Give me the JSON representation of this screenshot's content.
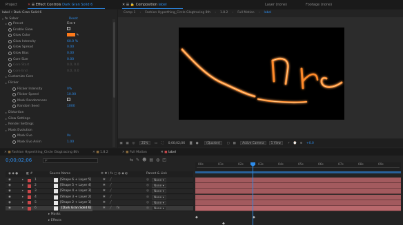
{
  "panels": {
    "project_tab": "Project",
    "effect_controls_tab": "Effect Controls",
    "effect_controls_layer": "Dark Gran Solid 6",
    "composition_tab": "Composition",
    "composition_name": "label",
    "layer_tab": "Layer (none)",
    "footage_tab": "Footage (none)"
  },
  "breadcrumbs": [
    "Comp 1",
    "Fashion Hyperthing_Circle Glogtracing 8th",
    "1.8.2",
    "Full Motion",
    "label"
  ],
  "effect_controls": {
    "title": "label • Dark Gran Solid 6",
    "effect_name": "Saber",
    "effect_reset": "Reset",
    "rows": [
      {
        "label": "Preset",
        "value": "Fire",
        "dim": false
      },
      {
        "label": "Enable Glow",
        "value": "",
        "dim": false
      },
      {
        "label": "Glow Color",
        "value": "",
        "dim": false
      },
      {
        "label": "Glow Intensity",
        "value": "60.0 %",
        "dim": false
      },
      {
        "label": "Glow Spread",
        "value": "0.00",
        "dim": false
      },
      {
        "label": "Glow Bias",
        "value": "0.00",
        "dim": false
      },
      {
        "label": "Core Size",
        "value": "0.00",
        "dim": false
      },
      {
        "label": "Core Start",
        "value": "0.0, 0.0",
        "dim": true
      },
      {
        "label": "Core End",
        "value": "0.0, 0.0",
        "dim": true
      },
      {
        "label": "Customize Core",
        "value": "",
        "dim": false
      },
      {
        "label": "Flicker",
        "value": "",
        "dim": false
      },
      {
        "label": "Flicker Intensity",
        "value": "0%",
        "dim": false
      },
      {
        "label": "Flicker Speed",
        "value": "10.00",
        "dim": false
      },
      {
        "label": "Mask Randomness",
        "value": "",
        "dim": false
      },
      {
        "label": "Random Seed",
        "value": "1000",
        "dim": false
      },
      {
        "label": "Distortion",
        "value": "",
        "dim": false
      },
      {
        "label": "Glow Settings",
        "value": "",
        "dim": false
      },
      {
        "label": "Render Settings",
        "value": "",
        "dim": false
      },
      {
        "label": "Mask Evolution",
        "value": "",
        "dim": false
      },
      {
        "label": "Mask Evo",
        "value": "0x",
        "dim": false
      },
      {
        "label": "Mask Evo Anim",
        "value": "1.00",
        "dim": false
      }
    ]
  },
  "viewer_toolbar": {
    "zoom": "25%",
    "timecode": "0;00;02;06",
    "resolution": "(Quarter)",
    "camera": "Active Camera",
    "views": "1 View",
    "offset": "+0.0"
  },
  "timeline": {
    "tabs": [
      "Fashion Hyperthing_Circle Glogtracing 8th",
      "1.8.2",
      "Full Motion",
      "label"
    ],
    "timecode": "0;00;02;06",
    "search_placeholder": "ρ-",
    "columns": {
      "source_name": "Source Name",
      "parent": "Parent & Link"
    },
    "ruler": [
      "00s",
      "01s",
      "02s",
      "03s",
      "04s",
      "05s",
      "06s",
      "07s",
      "08s",
      "09s"
    ],
    "layers": [
      {
        "num": "1",
        "name": "[Shape 6 + Layer 5]",
        "parent": "None"
      },
      {
        "num": "2",
        "name": "[Shape 5 + Layer 4]",
        "parent": "None"
      },
      {
        "num": "3",
        "name": "[Shape 4 + Layer 3]",
        "parent": "None"
      },
      {
        "num": "4",
        "name": "[Shape 3 + Layer 2]",
        "parent": "None"
      },
      {
        "num": "5",
        "name": "[Shape 2 + Layer 1]",
        "parent": "None"
      },
      {
        "num": "6",
        "name": "[Dark Gran Solid 6]",
        "parent": "None"
      }
    ],
    "sub_rows": [
      "Masks",
      "Effects"
    ]
  },
  "colors": {
    "accent": "#2d8ceb",
    "layer_bar": "#a35a5e",
    "label_red": "#c9474a",
    "saber": "#ff9a3c"
  }
}
